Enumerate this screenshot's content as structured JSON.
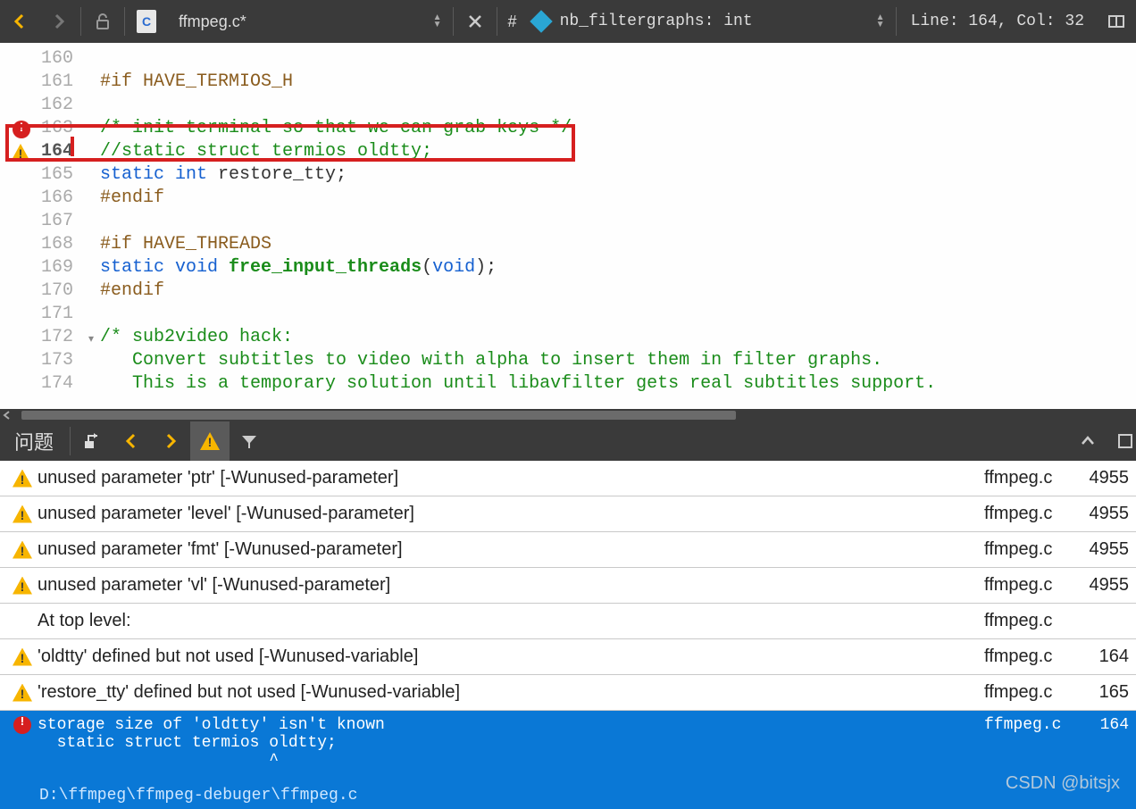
{
  "toolbar": {
    "filename": "ffmpeg.c*",
    "hash_label": "#",
    "symbol": "nb_filtergraphs: int",
    "status": "Line: 164, Col: 32",
    "file_icon_letter": "C"
  },
  "editor": {
    "gutter_marks": {
      "163": "error",
      "164": "warning"
    },
    "lines": [
      {
        "num": 160,
        "tokens": []
      },
      {
        "num": 161,
        "tokens": [
          {
            "t": "#if ",
            "c": "kw-pp"
          },
          {
            "t": "HAVE_TERMIOS_H",
            "c": "kw-pp"
          }
        ]
      },
      {
        "num": 162,
        "tokens": []
      },
      {
        "num": 163,
        "tokens": [
          {
            "t": "/* init terminal so that we can grab keys */",
            "c": "cmt"
          }
        ]
      },
      {
        "num": 164,
        "tokens": [
          {
            "t": "//static struct termios oldtty;",
            "c": "cmt"
          }
        ],
        "cursor": true
      },
      {
        "num": 165,
        "tokens": [
          {
            "t": "static ",
            "c": "kw-ty"
          },
          {
            "t": "int ",
            "c": "kw-ty"
          },
          {
            "t": "restore_tty",
            "c": "pn"
          },
          {
            "t": ";",
            "c": "pn"
          }
        ]
      },
      {
        "num": 166,
        "tokens": [
          {
            "t": "#endif",
            "c": "kw-pp"
          }
        ]
      },
      {
        "num": 167,
        "tokens": []
      },
      {
        "num": 168,
        "tokens": [
          {
            "t": "#if ",
            "c": "kw-pp"
          },
          {
            "t": "HAVE_THREADS",
            "c": "kw-pp"
          }
        ]
      },
      {
        "num": 169,
        "tokens": [
          {
            "t": "static ",
            "c": "kw-ty"
          },
          {
            "t": "void ",
            "c": "kw-ty"
          },
          {
            "t": "free_input_threads",
            "c": "fn"
          },
          {
            "t": "(",
            "c": "pn"
          },
          {
            "t": "void",
            "c": "kw-ty"
          },
          {
            "t": ")",
            "c": "pn"
          },
          {
            "t": ";",
            "c": "pn"
          }
        ]
      },
      {
        "num": 170,
        "tokens": [
          {
            "t": "#endif",
            "c": "kw-pp"
          }
        ]
      },
      {
        "num": 171,
        "tokens": []
      },
      {
        "num": 172,
        "tokens": [
          {
            "t": "/* sub2video hack:",
            "c": "cmt"
          }
        ],
        "fold": "collapse"
      },
      {
        "num": 173,
        "tokens": [
          {
            "t": "   Convert subtitles to video with alpha to insert them in filter graphs.",
            "c": "cmt"
          }
        ]
      },
      {
        "num": 174,
        "tokens": [
          {
            "t": "   This is a temporary solution until libavfilter gets real subtitles support.",
            "c": "cmt"
          }
        ]
      }
    ]
  },
  "problems": {
    "tab_title": "问题",
    "items": [
      {
        "type": "warning",
        "msg": "unused parameter 'ptr' [-Wunused-parameter]",
        "file": "ffmpeg.c",
        "line": "4955"
      },
      {
        "type": "warning",
        "msg": "unused parameter 'level' [-Wunused-parameter]",
        "file": "ffmpeg.c",
        "line": "4955"
      },
      {
        "type": "warning",
        "msg": "unused parameter 'fmt' [-Wunused-parameter]",
        "file": "ffmpeg.c",
        "line": "4955"
      },
      {
        "type": "warning",
        "msg": "unused parameter 'vl' [-Wunused-parameter]",
        "file": "ffmpeg.c",
        "line": "4955"
      },
      {
        "type": "none",
        "msg": "At top level:",
        "file": "ffmpeg.c",
        "line": ""
      },
      {
        "type": "warning",
        "msg": "'oldtty' defined but not used [-Wunused-variable]",
        "file": "ffmpeg.c",
        "line": "164"
      },
      {
        "type": "warning",
        "msg": "'restore_tty' defined but not used [-Wunused-variable]",
        "file": "ffmpeg.c",
        "line": "165"
      }
    ],
    "selected": {
      "type": "error",
      "msg": "storage size of 'oldtty' isn't known\n  static struct termios oldtty;\n                        ^",
      "file": "ffmpeg.c",
      "line": "164",
      "path": "D:\\ffmpeg\\ffmpeg-debuger\\ffmpeg.c"
    }
  },
  "watermark": "CSDN @bitsjx"
}
